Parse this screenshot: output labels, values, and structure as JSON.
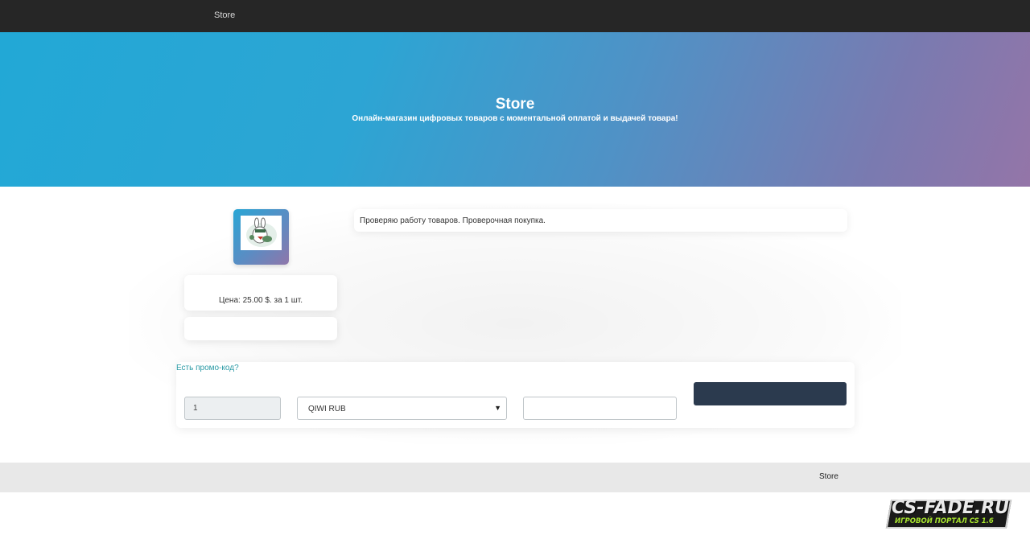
{
  "nav": {
    "brand": "Store"
  },
  "hero": {
    "title": "Store",
    "subtitle": "Онлайн-магазин цифровых товаров с моментальной оплатой и выдачей товара!"
  },
  "product": {
    "price_text": "Цена: 25.00 $. за 1 шт.",
    "description": "Проверяю работу товаров. Проверочная покупка."
  },
  "order": {
    "promo_link": "Есть промо-код?",
    "quantity": "1",
    "payment_method": "QIWI RUB",
    "email_value": "",
    "buy_label": ""
  },
  "footer": {
    "brand": "Store"
  },
  "watermark": {
    "main": "CS-FADE.RU",
    "sub": "ИГРОВОЙ ПОРТАЛ CS 1.6"
  },
  "colors": {
    "topbar": "#262626",
    "hero_start": "#22a8d6",
    "hero_end": "#9475a8",
    "button": "#2b3a4e",
    "link": "#2a9aa5",
    "footer": "#e8e8e8"
  }
}
